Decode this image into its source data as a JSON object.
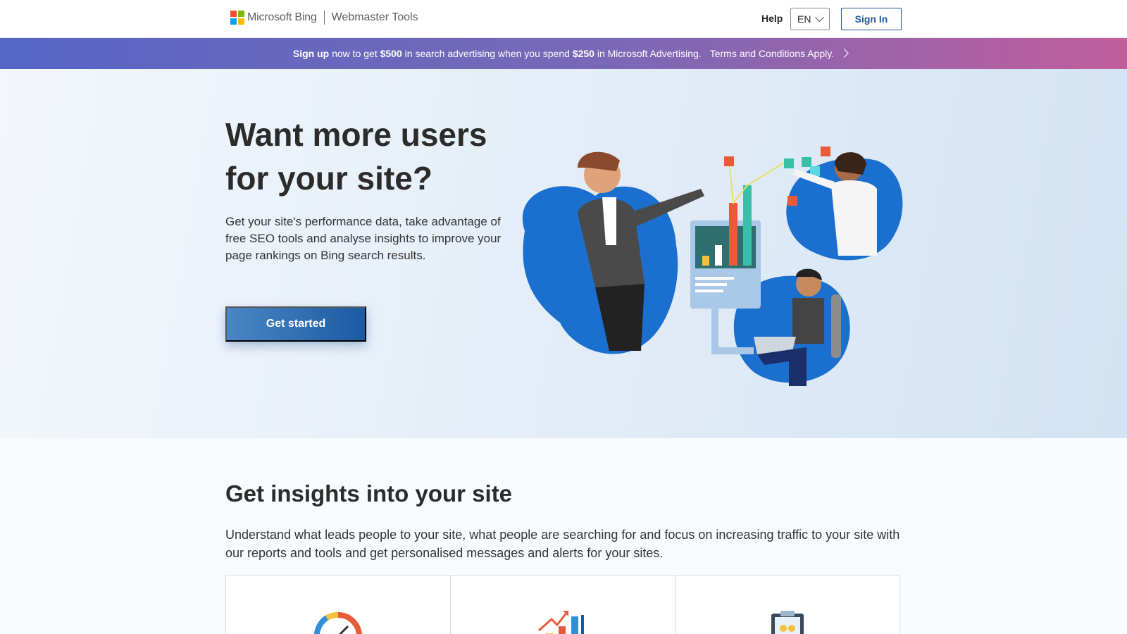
{
  "header": {
    "brand": "Microsoft Bing",
    "product": "Webmaster Tools",
    "help_label": "Help",
    "language": "EN",
    "signin_label": "Sign In",
    "ms_logo_colors": [
      "#f25022",
      "#7fba00",
      "#00a4ef",
      "#ffb900"
    ]
  },
  "promo": {
    "sign_up": "Sign up",
    "t1": "now to get",
    "amount1": "$500",
    "t2": "in search advertising when you spend",
    "amount2": "$250",
    "t3": "in Microsoft Advertising.",
    "terms": "Terms and Conditions Apply.",
    "arrow_icon": "chevron-right-icon"
  },
  "hero": {
    "title": "Want more users for your site?",
    "description": "Get your site's performance data, take advantage of free SEO tools and analyse insights to improve your page rankings on Bing search results.",
    "cta_label": "Get started"
  },
  "insights": {
    "title": "Get insights into your site",
    "description": "Understand what leads people to your site, what people are searching for and focus on increasing traffic to your site with our reports and tools and get personalised messages and alerts for your sites.",
    "cards": [
      {
        "icon": "gauge-icon"
      },
      {
        "icon": "bar-chart-trend-icon"
      },
      {
        "icon": "clipboard-icon"
      }
    ]
  },
  "colors": {
    "accent_blue": "#1f5a99",
    "illustration_blue": "#1a6fcf",
    "cta_gradient": [
      "#4a86c5",
      "#1c5ba3"
    ]
  }
}
